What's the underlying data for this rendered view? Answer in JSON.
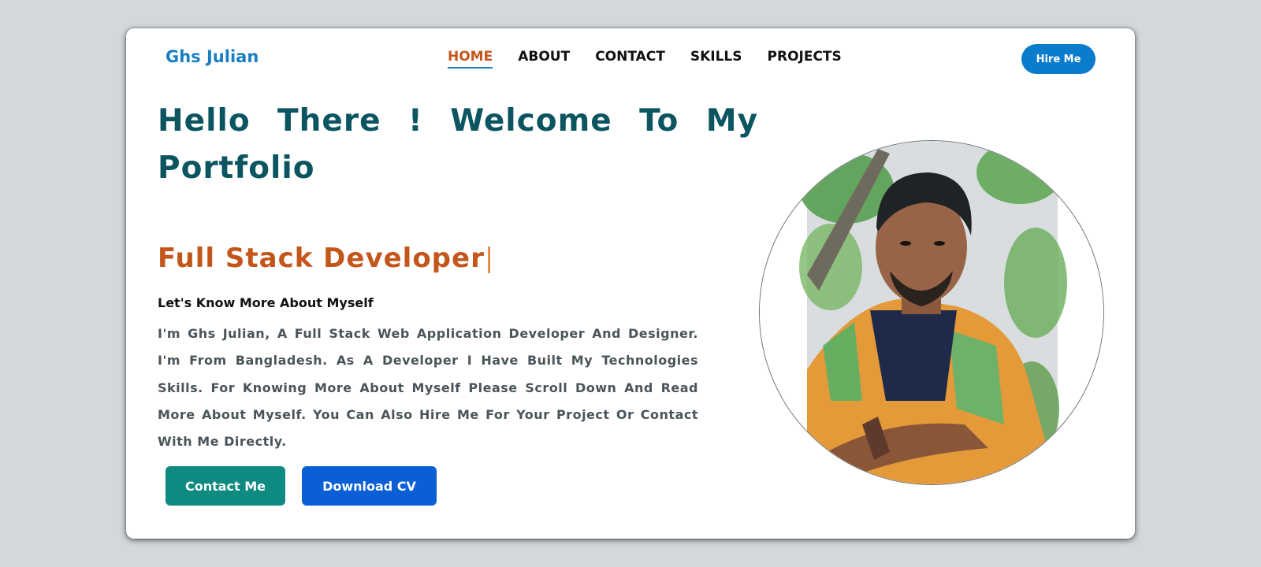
{
  "brand": {
    "name": "Ghs Julian"
  },
  "nav": {
    "items": [
      {
        "label": "HOME",
        "active": true
      },
      {
        "label": "ABOUT",
        "active": false
      },
      {
        "label": "CONTACT",
        "active": false
      },
      {
        "label": "SKILLS",
        "active": false
      },
      {
        "label": "PROJECTS",
        "active": false
      }
    ]
  },
  "header": {
    "hire_label": "Hire Me"
  },
  "hero": {
    "headline": "Hello There ! Welcome To My Portfolio",
    "role": "Full Stack Developer",
    "role_caret": "|",
    "subheading": "Let's Know More About Myself",
    "bio": "I'm Ghs Julian, A Full Stack Web Application Developer And Designer. I'm From Bangladesh. As A Developer I Have Built My Technologies Skills. For Knowing More About Myself Please Scroll Down And Read More About Myself. You Can Also Hire Me For Your Project Or Contact With Me Directly.",
    "buttons": {
      "contact_label": "Contact Me",
      "cv_label": "Download CV"
    }
  },
  "colors": {
    "brand": "#1a7fc1",
    "headline": "#0a5560",
    "accent": "#c4561b",
    "contact_button": "#0e8a80",
    "cv_button": "#0a5fd6",
    "page_background": "#d4d8db"
  }
}
